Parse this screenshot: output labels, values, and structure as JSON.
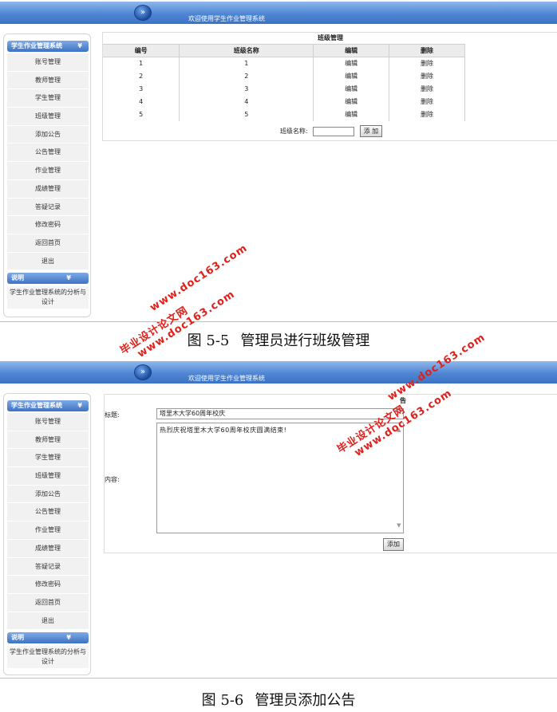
{
  "header": {
    "welcome": "欢迎使用学生作业管理系统",
    "logo_glyph": "»"
  },
  "sidebar": {
    "section_title": "学生作业管理系统",
    "section_chevron": "¥",
    "items": [
      "账号管理",
      "教师管理",
      "学生管理",
      "班级管理",
      "添加公告",
      "公告管理",
      "作业管理",
      "成绩管理",
      "答疑记录",
      "修改密码",
      "返回首页",
      "退出"
    ],
    "note_title": "说明",
    "note_chevron": "¥",
    "note_text_line1": "学生作业管理系统的分析与",
    "note_text_line2": "设计"
  },
  "class_mgmt": {
    "title": "班级管理",
    "columns": [
      "编号",
      "班级名称",
      "编辑",
      "删除"
    ],
    "rows": [
      [
        "1",
        "1",
        "编辑",
        "删除"
      ],
      [
        "2",
        "2",
        "编辑",
        "删除"
      ],
      [
        "3",
        "3",
        "编辑",
        "删除"
      ],
      [
        "4",
        "4",
        "编辑",
        "删除"
      ],
      [
        "5",
        "5",
        "编辑",
        "删除"
      ]
    ],
    "name_label": "班级名称:",
    "add_button": "添 加"
  },
  "announce": {
    "title_label": "标题:",
    "title_value": "塔里木大学60周年校庆",
    "content_label": "内容:",
    "content_value": "热烈庆祝塔里木大学60周年校庆圆满结束!",
    "add_button": "添加",
    "partial_heading": "告"
  },
  "captions": {
    "fig1_num": "图 5-5",
    "fig1_text": "管理员进行班级管理",
    "fig2_num": "图 5-6",
    "fig2_text": "管理员添加公告"
  },
  "watermark": {
    "text": "毕业设计论文网",
    "url": "www.doc163.com"
  },
  "colors": {
    "header_blue": "#4f86d4",
    "watermark_red": "#e0201a"
  }
}
